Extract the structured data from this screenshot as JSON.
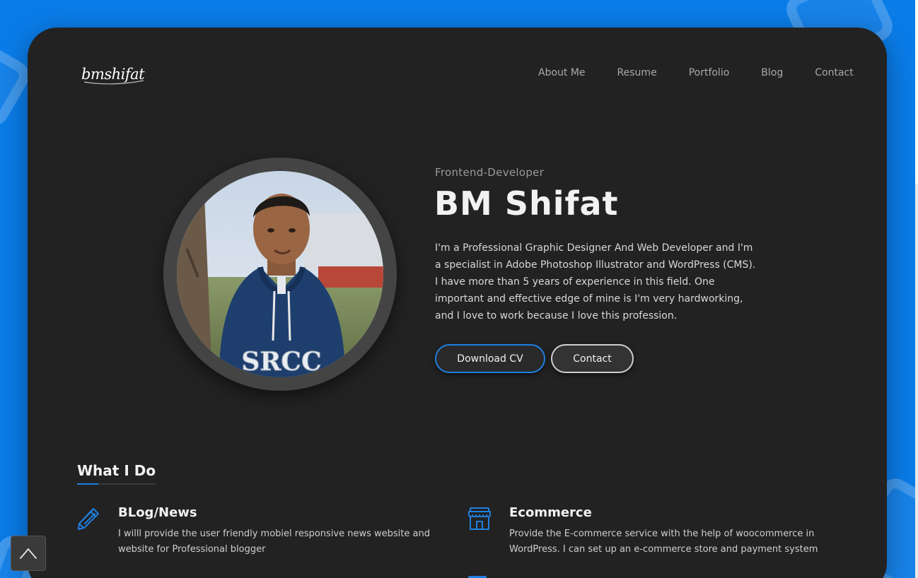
{
  "brand": {
    "logo_text": "bmshifat"
  },
  "nav": {
    "items": [
      "About Me",
      "Resume",
      "Portfolio",
      "Blog",
      "Contact"
    ]
  },
  "hero": {
    "subtitle": "Frontend-Developer",
    "name": "BM Shifat",
    "bio": "I'm a Professional Graphic Designer And Web Developer and I'm a specialist in Adobe Photoshop Illustrator and WordPress (CMS). I have more than 5 years of experience in this field. One important and effective edge of mine is I'm very hardworking, and I love to work because I love this profession.",
    "download_label": "Download CV",
    "contact_label": "Contact",
    "photo_shirt_text": "SRCC"
  },
  "services": {
    "title": "What I Do",
    "items": [
      {
        "icon": "pencil-icon",
        "title": "BLog/News",
        "description": "I willl provide the user friendly mobiel responsive news website and website for Professional blogger"
      },
      {
        "icon": "store-icon",
        "title": "Ecommerce",
        "description": "Provide the E-commerce service with the help of woocommerce in WordPress. I can set up an e-commerce store and payment system"
      }
    ]
  },
  "colors": {
    "page_background": "#0a7ce8",
    "card_background": "#222222",
    "accent": "#1f7fe0",
    "text_primary": "#f2f2f2",
    "text_muted": "#a9a9a9"
  }
}
